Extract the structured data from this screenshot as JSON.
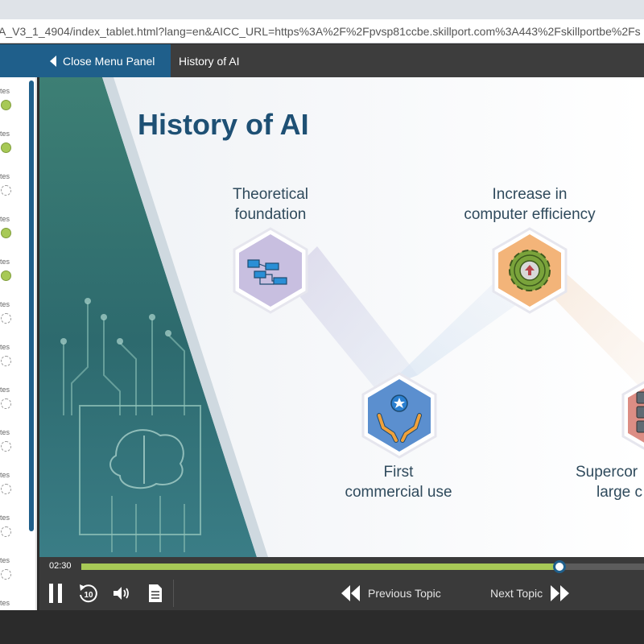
{
  "browser": {
    "url": "A_V3_1_4904/index_tablet.html?lang=en&AICC_URL=https%3A%2F%2Fpvsp81ccbe.skillport.com%3A443%2Fskillportbe%2Fs"
  },
  "header": {
    "close_menu_label": "Close Menu Panel",
    "course_title": "History of AI"
  },
  "menu_panel": {
    "items": [
      {
        "label": "tes",
        "status": "completed"
      },
      {
        "label": "tes",
        "status": "completed"
      },
      {
        "label": "tes",
        "status": "not-started"
      },
      {
        "label": "tes",
        "status": "completed"
      },
      {
        "label": "tes",
        "status": "completed"
      },
      {
        "label": "tes",
        "status": "not-started"
      },
      {
        "label": "tes",
        "status": "not-started"
      },
      {
        "label": "tes",
        "status": "not-started"
      },
      {
        "label": "tes",
        "status": "not-started"
      },
      {
        "label": "tes",
        "status": "not-started"
      },
      {
        "label": "tes",
        "status": "not-started"
      },
      {
        "label": "tes",
        "status": "not-started"
      },
      {
        "label": "tes",
        "status": "not-started"
      }
    ]
  },
  "slide": {
    "title": "History of AI",
    "milestones": [
      {
        "line1": "Theoretical",
        "line2": "foundation",
        "icon": "flowchart-icon"
      },
      {
        "line1": "First",
        "line2": "commercial use",
        "icon": "hands-star-icon"
      },
      {
        "line1": "Increase in",
        "line2": "computer efficiency",
        "icon": "gear-upload-icon"
      },
      {
        "line1": "Supercor",
        "line2": "large c",
        "icon": "server-stack-icon"
      }
    ]
  },
  "player": {
    "current_time": "02:30",
    "progress": 0.85,
    "prev_label": "Previous Topic",
    "next_label": "Next Topic"
  },
  "colors": {
    "accent_blue": "#1f5f8b",
    "progress_green": "#a7c956",
    "title_navy": "#1e5074"
  }
}
